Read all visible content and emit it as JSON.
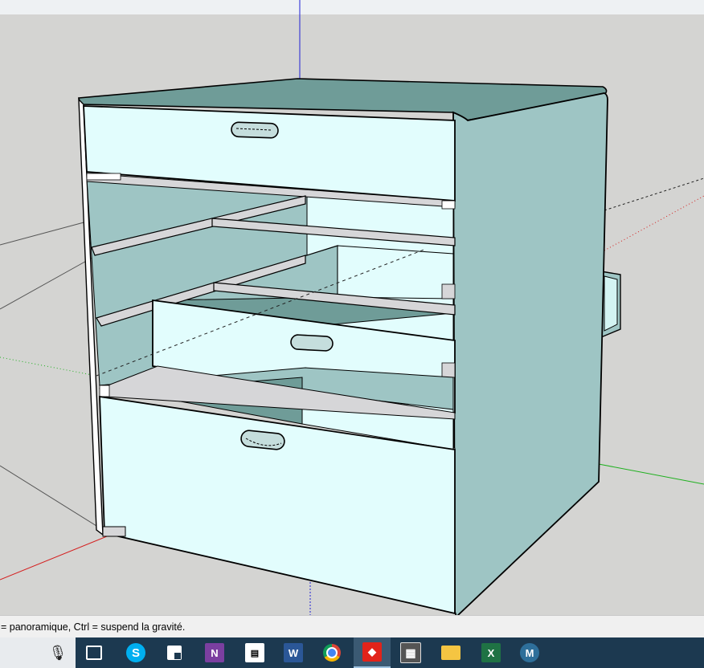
{
  "app": {
    "name": "SketchUp"
  },
  "status_bar": {
    "text": "= panoramique, Ctrl =  suspend la gravité."
  },
  "colors": {
    "face_front": "#e2fdfd",
    "face_side": "#9ec5c4",
    "face_top": "#6f9c98",
    "shelf": "#d6d6d8",
    "background": "#d4d4d2",
    "axis_blue": "#1f1fd6",
    "axis_red": "#d41f1f",
    "axis_green": "#1fb01f"
  },
  "taskbar": {
    "items": [
      {
        "name": "microphone-icon",
        "glyph": "🎙"
      },
      {
        "name": "task-view-icon",
        "glyph": "⧉"
      },
      {
        "name": "skype-icon",
        "glyph": "S"
      },
      {
        "name": "sticky-notes-icon",
        "glyph": "◪"
      },
      {
        "name": "onenote-icon",
        "glyph": "N"
      },
      {
        "name": "video-editor-icon",
        "glyph": "🎬"
      },
      {
        "name": "word-icon",
        "glyph": "W"
      },
      {
        "name": "chrome-icon",
        "glyph": "◉"
      },
      {
        "name": "sketchup-icon",
        "glyph": "◆"
      },
      {
        "name": "calculator-icon",
        "glyph": "▦"
      },
      {
        "name": "file-explorer-icon",
        "glyph": "▬"
      },
      {
        "name": "excel-icon",
        "glyph": "X"
      },
      {
        "name": "malwarebytes-icon",
        "glyph": "M"
      }
    ]
  }
}
